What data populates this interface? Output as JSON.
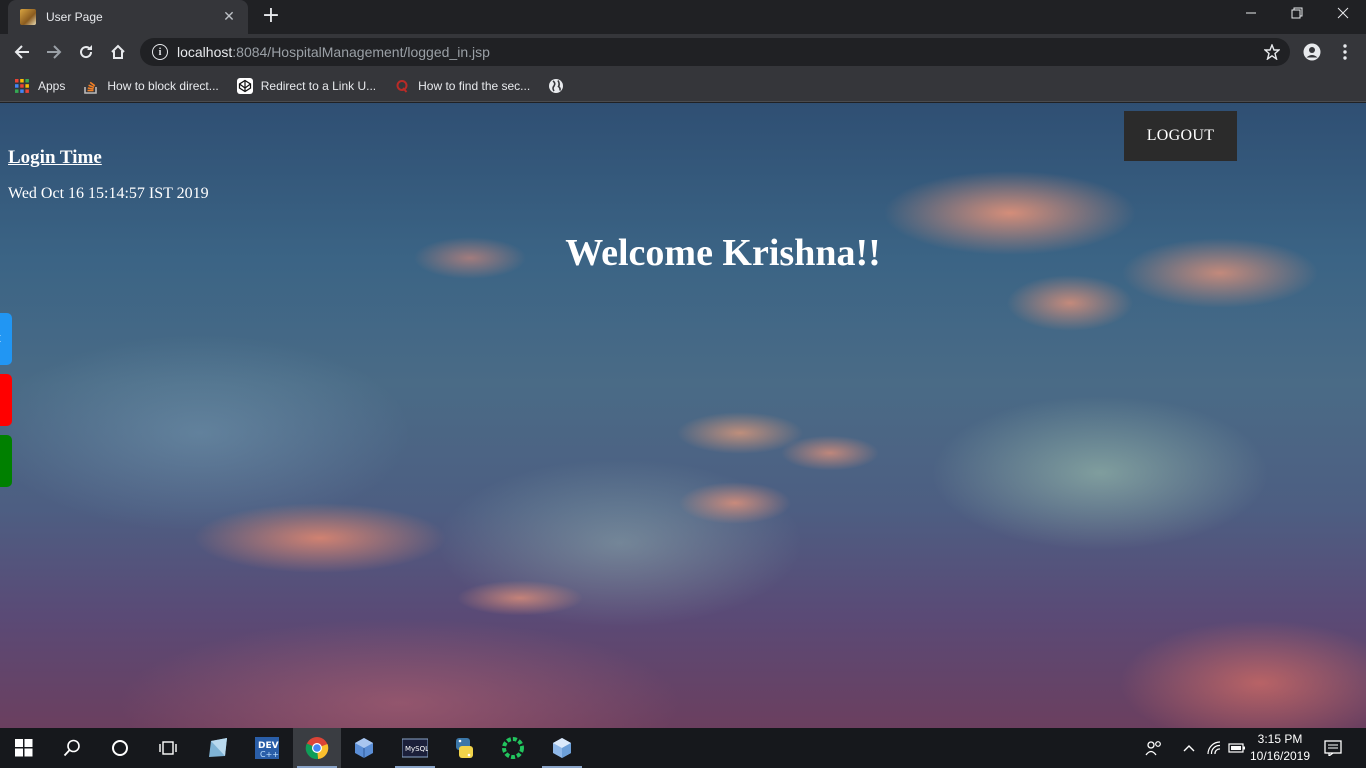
{
  "browser": {
    "tab": {
      "title": "User Page",
      "close": "✕"
    },
    "new_tab": "+",
    "window_controls": {
      "minimize": "—",
      "restore": "❐",
      "close": "✕"
    },
    "url": {
      "host": "localhost",
      "path": ":8084/HospitalManagement/logged_in.jsp"
    },
    "bookmarks": [
      {
        "label": "Apps",
        "icon": "apps-grid-icon"
      },
      {
        "label": "How to block direct...",
        "icon": "stackoverflow-icon"
      },
      {
        "label": "Redirect to a Link U...",
        "icon": "codepen-icon"
      },
      {
        "label": "How to find the sec...",
        "icon": "quora-icon"
      },
      {
        "label": "",
        "icon": "globe-icon"
      }
    ]
  },
  "page": {
    "login_time_heading": "Login Time",
    "login_date": "Wed Oct 16 15:14:57 IST 2019",
    "welcome": "Welcome Krishna!!",
    "logout_label": "LOGOUT",
    "side_tabs": [
      {
        "color": "#2196f3",
        "letter": "t"
      },
      {
        "color": "#ff0000",
        "letter": ""
      },
      {
        "color": "#008000",
        "letter": ""
      }
    ]
  },
  "taskbar": {
    "time": "3:15 PM",
    "date": "10/16/2019"
  }
}
